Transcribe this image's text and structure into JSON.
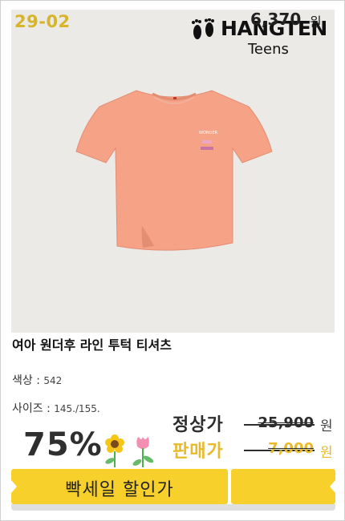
{
  "item_code": "29-02",
  "brand": {
    "name": "HANGTEN",
    "sub": "Teens"
  },
  "product": {
    "name": "여아 원더후 라인 투턱 티셔츠",
    "shirt_color": "#f6a287"
  },
  "specs": {
    "color_label": "색상 :",
    "color_value": "542",
    "size_label": "사이즈 :",
    "size_value": "145./155."
  },
  "discount": "75%",
  "prices": {
    "regular_label": "정상가",
    "regular_value": "25,900",
    "sale_label": "판매가",
    "sale_value": "7,000",
    "currency": "원"
  },
  "banner": {
    "title": "빡세일 할인가",
    "price": "6,370",
    "currency": "원"
  },
  "colors": {
    "accent_yellow": "#f7d02b",
    "code_gold": "#d6b52a",
    "sale_gold": "#e8b92b",
    "photo_bg": "#ebeae7"
  },
  "icons": [
    "footprints-icon",
    "sunflower-icon",
    "tulip-icon",
    "tshirt-image"
  ]
}
